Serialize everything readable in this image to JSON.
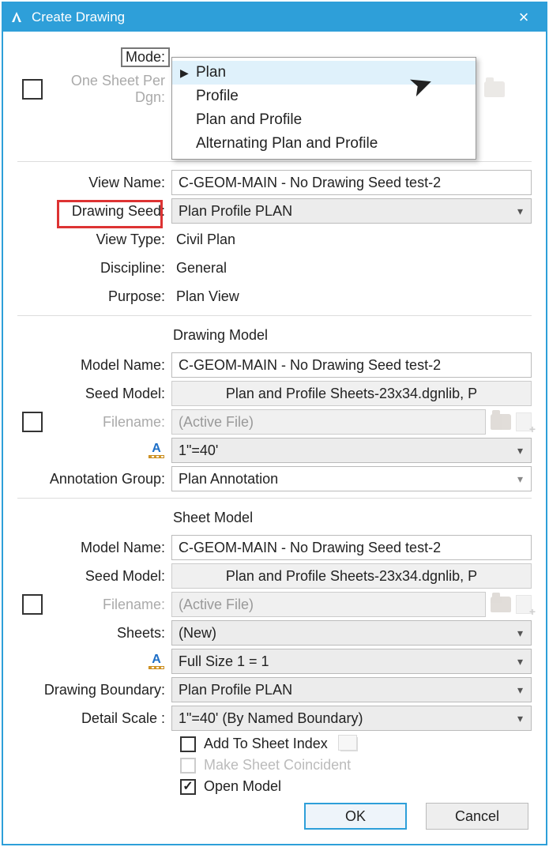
{
  "window": {
    "title": "Create Drawing"
  },
  "labels": {
    "mode": "Mode:",
    "one_sheet": "One Sheet Per Dgn:",
    "view_name": "View Name:",
    "drawing_seed": "Drawing Seed:",
    "view_type": "View Type:",
    "discipline": "Discipline:",
    "purpose": "Purpose:",
    "drawing_model": "Drawing Model",
    "model_name": "Model Name:",
    "seed_model": "Seed Model:",
    "filename": "Filename:",
    "annotation_group": "Annotation Group:",
    "sheet_model": "Sheet Model",
    "sheets": "Sheets:",
    "drawing_boundary": "Drawing Boundary:",
    "detail_scale": "Detail Scale :",
    "add_sheet_index": "Add To Sheet Index",
    "make_coincident": "Make Sheet Coincident",
    "open_model": "Open Model",
    "ok": "OK",
    "cancel": "Cancel"
  },
  "dropdown": {
    "items": [
      "Plan",
      "Profile",
      "Plan and Profile",
      "Alternating Plan and Profile"
    ],
    "selected_index": 0
  },
  "values": {
    "view_name": "C-GEOM-MAIN - No Drawing Seed test-2",
    "drawing_seed": "Plan Profile PLAN",
    "view_type": "Civil Plan",
    "discipline": "General",
    "purpose": "Plan View",
    "dm_model_name": "C-GEOM-MAIN - No Drawing Seed test-2",
    "dm_seed_model": "Plan and Profile Sheets-23x34.dgnlib, P",
    "dm_filename": "(Active File)",
    "dm_scale": "1\"=40'",
    "dm_annotation_group": "Plan Annotation",
    "sm_model_name": "C-GEOM-MAIN - No Drawing Seed test-2",
    "sm_seed_model": "Plan and Profile Sheets-23x34.dgnlib, P",
    "sm_filename": "(Active File)",
    "sm_sheets": "(New)",
    "sm_scale": "Full Size 1 = 1",
    "sm_boundary": "Plan Profile PLAN",
    "sm_detail_scale": "1\"=40' (By Named Boundary)"
  },
  "checks": {
    "one_sheet": false,
    "dm_file": false,
    "sm_file": false,
    "add_sheet_index": false,
    "make_coincident": false,
    "open_model": true
  }
}
